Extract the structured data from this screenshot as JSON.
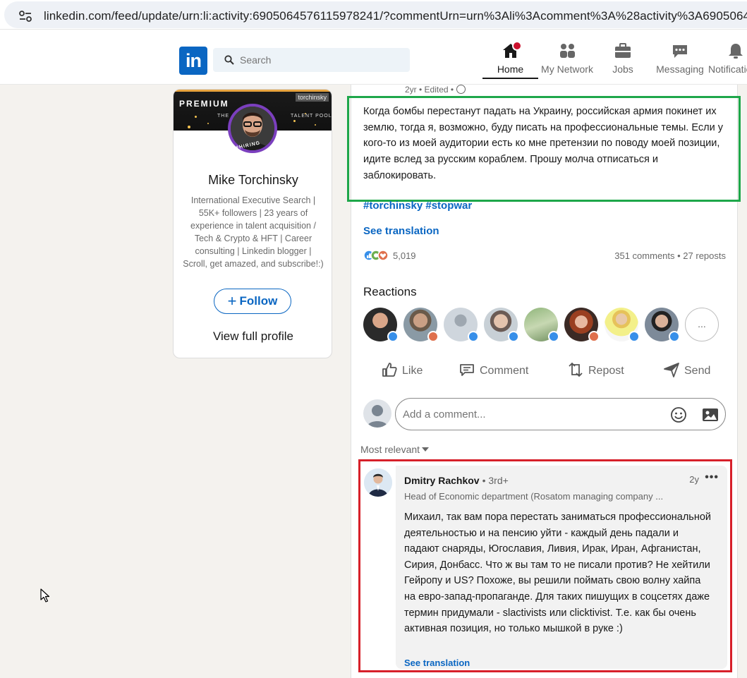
{
  "browser": {
    "url": "linkedin.com/feed/update/urn:li:activity:6905064576115978241/?commentUrn=urn%3Ali%3Acomment%3A%28activity%3A6905064"
  },
  "nav": {
    "logo_text": "in",
    "search_placeholder": "Search",
    "items": [
      {
        "label": "Home",
        "icon": "home-icon"
      },
      {
        "label": "My Network",
        "icon": "network-icon"
      },
      {
        "label": "Jobs",
        "icon": "jobs-icon"
      },
      {
        "label": "Messaging",
        "icon": "messaging-icon"
      },
      {
        "label": "Notifications",
        "icon": "bell-icon"
      }
    ]
  },
  "profile": {
    "banner_label": "PREMIUM",
    "banner_tag": "torchinsky",
    "banner_sub_left": "THE",
    "banner_sub_right": "TALENT POOL",
    "hiring_label": "#HIRING",
    "name": "Mike Torchinsky",
    "headline": "International Executive Search | 55K+ followers | 23 years of experience in talent acquisition / Tech & Crypto & HFT | Career consulting | Linkedin blogger | Scroll, get amazed, and subscribe!:)",
    "follow_label": "Follow",
    "view_profile_label": "View full profile"
  },
  "post": {
    "meta": "2yr • Edited •",
    "text": "Когда бомбы перестанут падать на Украину, российская армия покинет их землю, тогда я, возможно, буду писать на профессиональные темы. Если у кого-то из моей аудитории есть ко мне претензии по поводу моей позиции, идите вслед за русским кораблем. Прошу молча отписаться и заблокировать.",
    "hashtags": "#torchinsky #stopwar",
    "see_translation": "See translation",
    "reaction_count": "5,019",
    "comment_counts": "351 comments • 27 reposts",
    "reactions_title": "Reactions",
    "more_reactors": "...",
    "actions": [
      {
        "label": "Like",
        "icon": "like-icon"
      },
      {
        "label": "Comment",
        "icon": "comment-icon"
      },
      {
        "label": "Repost",
        "icon": "repost-icon"
      },
      {
        "label": "Send",
        "icon": "send-icon"
      }
    ],
    "comment_placeholder": "Add a comment...",
    "sort_label": "Most relevant"
  },
  "comment": {
    "author": "Dmitry Rachkov",
    "degree": "• 3rd+",
    "time": "2y",
    "more": "•••",
    "headline": "Head of Economic department (Rosatom managing company ...",
    "text": "Михаил, так вам пора перестать заниматься профессиональной деятельностью и на пенсию уйти - каждый день падали и падают снаряды, Югославия, Ливия, Ирак, Иран, Афганистан, Сирия, Донбасс. Что ж вы там то не писали против? Не хейтили Гейропу и US? Похоже, вы решили поймать свою волну хайпа на евро-запад-пропаганде. Для таких пишущих в соцсетях даже термин придумали - slactivists или clicktivist. Т.е. как бы очень активная позиция, но только мышкой в руке :)",
    "see_translation": "See translation"
  },
  "colors": {
    "linkedin_blue": "#0a66c2",
    "highlight_green": "#1ea74a",
    "highlight_red": "#d7202a",
    "notification_red": "#cb112d"
  }
}
